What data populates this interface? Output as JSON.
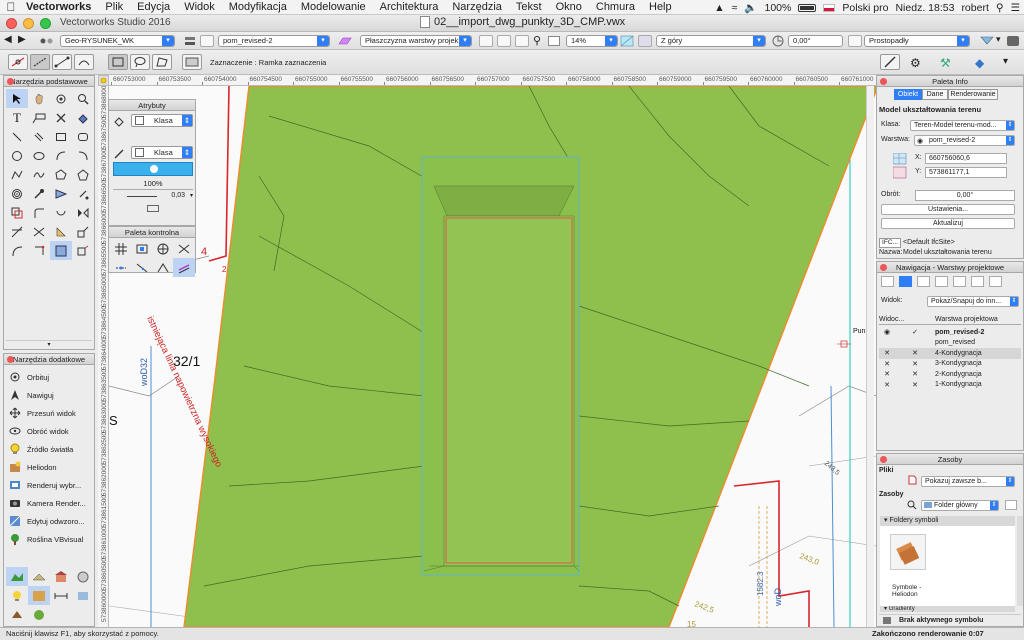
{
  "menubar": {
    "app_name": "Vectorworks",
    "items": [
      "Plik",
      "Edycja",
      "Widok",
      "Modyfikacja",
      "Modelowanie",
      "Architektura",
      "Narzędzia",
      "Tekst",
      "Okno",
      "Chmura",
      "Help"
    ],
    "battery": "100%",
    "input_source": "Polski pro",
    "clock": "Niedz. 18:53",
    "user": "robert"
  },
  "window": {
    "app_title": "Vectorworks Studio 2016",
    "file_name": "02__import_dwg_punkty_3D_CMP.vwx"
  },
  "view_bar": {
    "class_value": "Geo-RYSUNEK_WK",
    "layer_value": "pom_revised-2",
    "plane_value": "Płaszczyzna warstwy projek...",
    "zoom_value": "14%",
    "view_value": "Z góry",
    "angle_value": "0,00°",
    "projection_value": "Prostopadły"
  },
  "mode_bar": {
    "mode_text": "Zaznaczenie : Ramka zaznaczenia"
  },
  "ruler": {
    "top_labels": [
      "660753000",
      "660753500",
      "660754000",
      "660754500",
      "660755000",
      "660755500",
      "660756000",
      "660756500",
      "660757000",
      "660757500",
      "660758000",
      "660758500",
      "660759000",
      "660759500",
      "660760000",
      "660760500",
      "660761000"
    ],
    "left_labels": [
      "573868000",
      "573867500",
      "573867000",
      "573866500",
      "573866000",
      "573865500",
      "573865000",
      "573864500",
      "573864000",
      "573863500",
      "573863000",
      "573862500",
      "573862000",
      "573861500",
      "573861000",
      "573860500",
      "573860000"
    ]
  },
  "basic_tools": {
    "title": "Narzędzia podstawowe"
  },
  "attributes": {
    "title": "Atrybuty",
    "fill_class": "Klasa",
    "pen_class": "Klasa",
    "opacity": "100%",
    "line_weight": "0,03"
  },
  "snap_palette": {
    "title": "Paleta kontrolna"
  },
  "extra_tools": {
    "title": "Narzędzia dodatkowe",
    "items": [
      "Orbituj",
      "Nawiguj",
      "Przesuń widok",
      "Obróć widok",
      "Źródło światła",
      "Heliodon",
      "Renderuj wybr...",
      "Kamera Render...",
      "Edytuj odwzoro...",
      "Roślina VBvisual"
    ]
  },
  "drawing": {
    "labels": {
      "parcel": "32/1",
      "line_label": "istniejąca linia napowietrzna wysokiego",
      "wod_left": "woD32",
      "s_letter": "S",
      "point_label": "Punk",
      "num_4": "4",
      "num_2": "2",
      "elev_243_0": "243,0",
      "elev_242_5": "242,5",
      "elev_2435": "243,5",
      "num_15": "15",
      "wod_right": "woD",
      "val_15823": "1582.3"
    }
  },
  "info_palette": {
    "title": "Paleta Info",
    "tabs": [
      "Obiekt",
      "Dane",
      "Renderowanie"
    ],
    "object_type": "Model ukształtowania terenu",
    "class_label": "Klasa:",
    "class_value": "Teren-Modeł terenu-mod...",
    "layer_label": "Warstwa:",
    "layer_value": "pom_revised-2",
    "x_label": "X:",
    "x_value": "660756060,6",
    "y_label": "Y:",
    "y_value": "573861177,1",
    "rotation_label": "Obrót:",
    "rotation_value": "0,00°",
    "settings_button": "Ustawienia...",
    "update_button": "Aktualizuj",
    "ifc_badge": "IFC...",
    "ifc_value": "<Default IfcSite>",
    "name_label": "Nazwa:",
    "name_value": "Model ukształtowania terenu"
  },
  "navigation": {
    "title": "Nawigacja - Warstwy projektowe",
    "view_label": "Widok:",
    "view_value": "Pokaż/Snapuj do inn...",
    "col_visibility": "Widoc...",
    "col_layers": "Warstwa projektowa",
    "layers": [
      {
        "mark": "✓",
        "name": "pom_revised-2",
        "active": false,
        "bold": true
      },
      {
        "mark": "",
        "name": "pom_revised",
        "active": false,
        "bold": false
      },
      {
        "mark": "✕",
        "name": "4-Kondygnacja",
        "active": true,
        "bold": false
      },
      {
        "mark": "✕",
        "name": "3-Kondygnacja",
        "active": false,
        "bold": false
      },
      {
        "mark": "✕",
        "name": "2-Kondygnacja",
        "active": false,
        "bold": false
      },
      {
        "mark": "✕",
        "name": "1-Kondygnacja",
        "active": false,
        "bold": false
      }
    ]
  },
  "resources": {
    "title": "Zasoby",
    "files_label": "Pliki",
    "files_value": "Pokazuj zawsze b...",
    "resources_label": "Zasoby",
    "folder_value": "Folder główny",
    "folder_section": "Foldery symboli",
    "symbol_name": "Symbole - Heliodon",
    "gradients_label": "Gradienty",
    "no_symbol": "Brak aktywnego symbolu"
  },
  "status": {
    "hint": "Naciśnij klawisz F1, aby skorzystać z pomocy.",
    "render_status": "Zakończono renderowanie 0:07"
  },
  "colors": {
    "terrain": "#8fbf4d",
    "accent": "#2f7ef6",
    "boundary": "#f08a2c",
    "red_line": "#d8262a"
  }
}
